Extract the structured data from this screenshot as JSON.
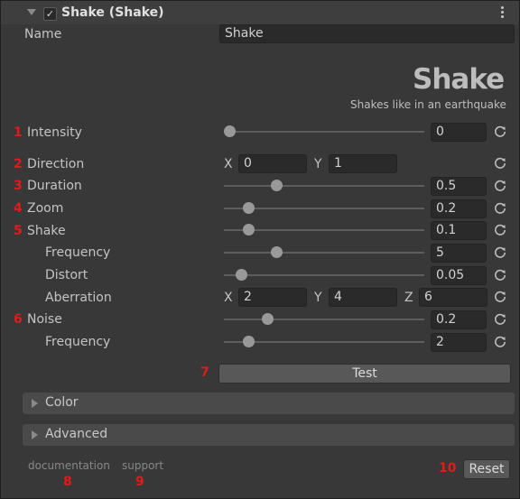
{
  "header": {
    "title": "Shake (Shake)",
    "enabled_check": "✓"
  },
  "name_row": {
    "label": "Name",
    "value": "Shake"
  },
  "logo": {
    "text": "Shake",
    "subtitle": "Shakes like in an earthquake"
  },
  "params": {
    "intensity": {
      "num": "1",
      "label": "Intensity",
      "value": "0",
      "slider": 0.0
    },
    "direction": {
      "num": "2",
      "label": "Direction",
      "x_label": "X",
      "x": "0",
      "y_label": "Y",
      "y": "1"
    },
    "duration": {
      "num": "3",
      "label": "Duration",
      "value": "0.5",
      "slider": 0.25
    },
    "zoom": {
      "num": "4",
      "label": "Zoom",
      "value": "0.2",
      "slider": 0.1
    },
    "shake": {
      "num": "5",
      "label": "Shake",
      "value": "0.1",
      "slider": 0.1
    },
    "frequency": {
      "label": "Frequency",
      "value": "5",
      "slider": 0.25
    },
    "distort": {
      "label": "Distort",
      "value": "0.05",
      "slider": 0.06
    },
    "aberration": {
      "label": "Aberration",
      "x_label": "X",
      "x": "2",
      "y_label": "Y",
      "y": "4",
      "z_label": "Z",
      "z": "6"
    },
    "noise": {
      "num": "6",
      "label": "Noise",
      "value": "0.2",
      "slider": 0.2
    },
    "noise_frequency": {
      "label": "Frequency",
      "value": "2",
      "slider": 0.1
    }
  },
  "test": {
    "num": "7",
    "label": "Test"
  },
  "foldouts": {
    "color": "Color",
    "advanced": "Advanced"
  },
  "footer": {
    "documentation": "documentation",
    "documentation_num": "8",
    "support": "support",
    "support_num": "9",
    "reset_num": "10",
    "reset_label": "Reset"
  },
  "colors": {
    "annotation": "#e11b1b",
    "background": "#383838"
  }
}
